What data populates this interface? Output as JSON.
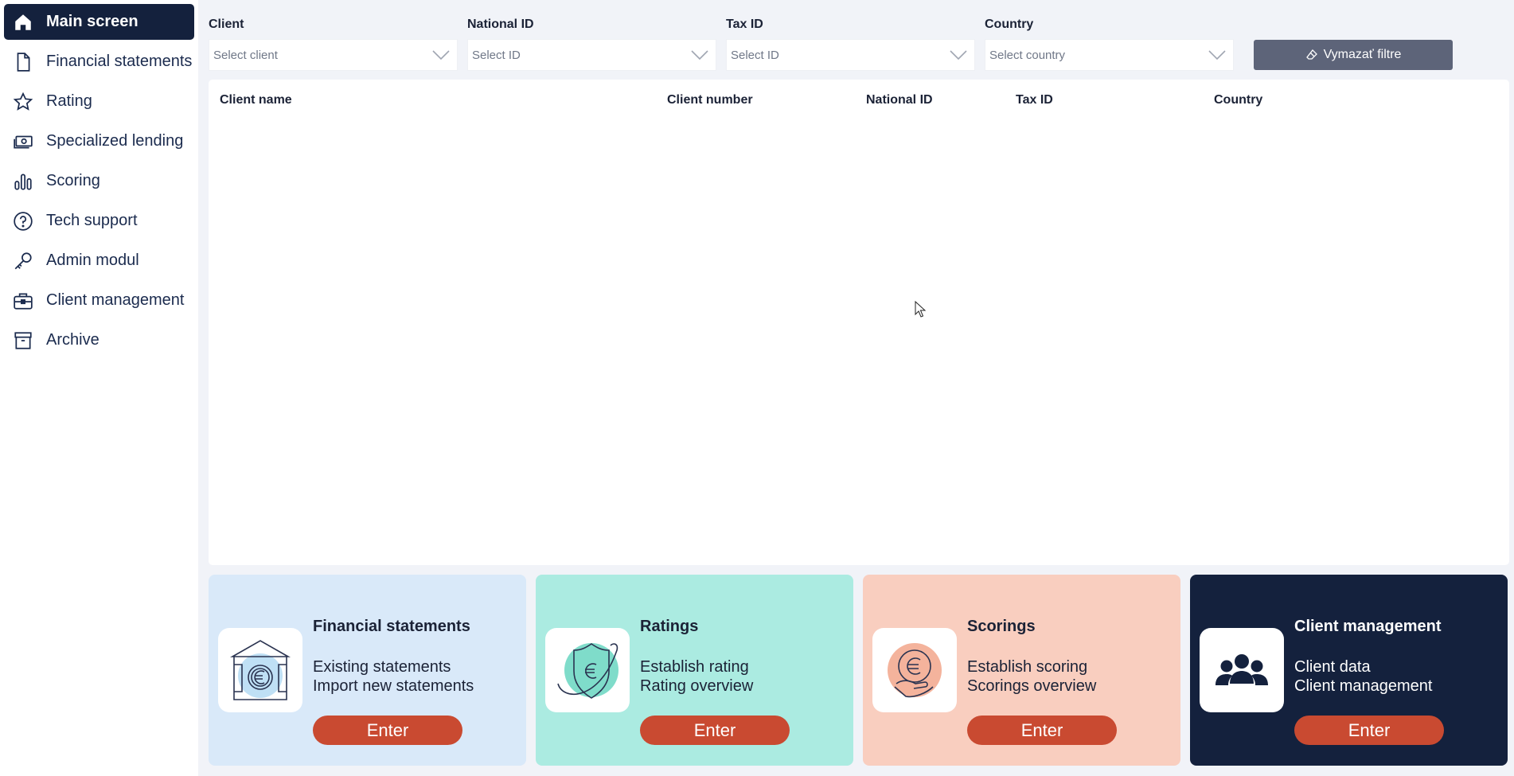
{
  "sidebar": {
    "items": [
      {
        "label": "Main screen",
        "icon": "home-icon",
        "active": true
      },
      {
        "label": "Financial statements",
        "icon": "document-icon"
      },
      {
        "label": "Rating",
        "icon": "star-icon"
      },
      {
        "label": "Specialized lending",
        "icon": "banknote-icon"
      },
      {
        "label": "Scoring",
        "icon": "bar-chart-icon"
      },
      {
        "label": "Tech support",
        "icon": "help-circle-icon"
      },
      {
        "label": "Admin modul",
        "icon": "key-icon"
      },
      {
        "label": "Client management",
        "icon": "briefcase-icon"
      },
      {
        "label": "Archive",
        "icon": "archive-icon"
      }
    ]
  },
  "filters": {
    "client": {
      "label": "Client",
      "placeholder": "Select client"
    },
    "national_id": {
      "label": "National ID",
      "placeholder": "Select ID"
    },
    "tax_id": {
      "label": "Tax ID",
      "placeholder": "Select ID"
    },
    "country": {
      "label": "Country",
      "placeholder": "Select country"
    },
    "clear_label": "Vymazať filtre"
  },
  "table": {
    "columns": [
      "Client name",
      "Client number",
      "National ID",
      "Tax ID",
      "Country"
    ],
    "rows": []
  },
  "cards": [
    {
      "title": "Financial statements",
      "line1": "Existing statements",
      "line2": "Import new statements",
      "button": "Enter",
      "bg": "#d9e9f9",
      "fg": "#1b2236",
      "icon": "building-euro-icon"
    },
    {
      "title": "Ratings",
      "line1": "Establish rating",
      "line2": "Rating overview",
      "button": "Enter",
      "bg": "#abebe1",
      "fg": "#1b2236",
      "icon": "shield-euro-icon"
    },
    {
      "title": "Scorings",
      "line1": "Establish scoring",
      "line2": "Scorings overview",
      "button": "Enter",
      "bg": "#f9cebf",
      "fg": "#1b2236",
      "icon": "hand-euro-icon"
    },
    {
      "title": "Client management",
      "line1": "Client data",
      "line2": "Client management",
      "button": "Enter",
      "bg": "#14213d",
      "fg": "#ffffff",
      "icon": "users-icon"
    }
  ],
  "colors": {
    "sidebar_active": "#14213d",
    "enter_button": "#c94a31",
    "clear_button": "#5d6479"
  }
}
